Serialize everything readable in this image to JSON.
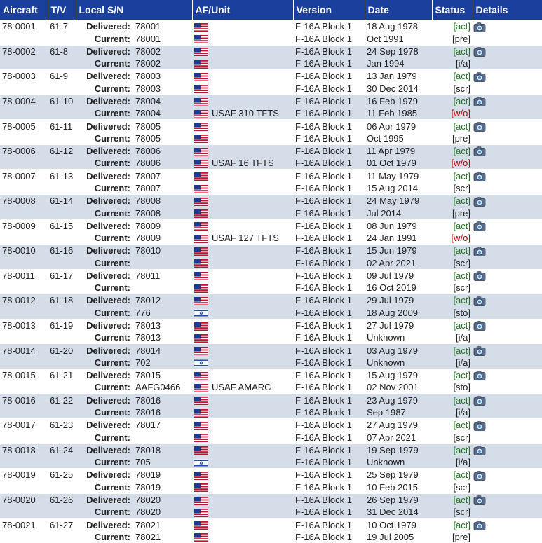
{
  "columns": [
    "Aircraft",
    "T/V",
    "Local S/N",
    "AF/Unit",
    "Version",
    "Date",
    "Status",
    "",
    "Details"
  ],
  "labels": {
    "delivered": "Delivered:",
    "current": "Current:"
  },
  "details_label": "Details",
  "rows": [
    {
      "aircraft": "78-0001",
      "tv": "61-7",
      "d_sn": "78001",
      "d_unit": "",
      "d_flag": "us",
      "d_ver": "F-16A Block 1",
      "d_date": "18 Aug 1978",
      "c_sn": "78001",
      "c_unit": "",
      "c_flag": "us",
      "c_ver": "F-16A Block 1",
      "c_date": "Oct 1991",
      "status": "[pre]",
      "status_color": "pre"
    },
    {
      "aircraft": "78-0002",
      "tv": "61-8",
      "d_sn": "78002",
      "d_unit": "",
      "d_flag": "us",
      "d_ver": "F-16A Block 1",
      "d_date": "24 Sep 1978",
      "c_sn": "78002",
      "c_unit": "",
      "c_flag": "us",
      "c_ver": "F-16A Block 1",
      "c_date": "Jan 1994",
      "status": "[i/a]",
      "status_color": "ia"
    },
    {
      "aircraft": "78-0003",
      "tv": "61-9",
      "d_sn": "78003",
      "d_unit": "",
      "d_flag": "us",
      "d_ver": "F-16A Block 1",
      "d_date": "13 Jan 1979",
      "c_sn": "78003",
      "c_unit": "",
      "c_flag": "us",
      "c_ver": "F-16A Block 1",
      "c_date": "30 Dec 2014",
      "status": "[scr]",
      "status_color": "scr"
    },
    {
      "aircraft": "78-0004",
      "tv": "61-10",
      "d_sn": "78004",
      "d_unit": "",
      "d_flag": "us",
      "d_ver": "F-16A Block 1",
      "d_date": "16 Feb 1979",
      "c_sn": "78004",
      "c_unit": "USAF 310 TFTS",
      "c_flag": "us",
      "c_ver": "F-16A Block 1",
      "c_date": "11 Feb 1985",
      "status": "[w/o]",
      "status_color": "wo"
    },
    {
      "aircraft": "78-0005",
      "tv": "61-11",
      "d_sn": "78005",
      "d_unit": "",
      "d_flag": "us",
      "d_ver": "F-16A Block 1",
      "d_date": "06 Apr 1979",
      "c_sn": "78005",
      "c_unit": "",
      "c_flag": "us",
      "c_ver": "F-16A Block 1",
      "c_date": "Oct 1995",
      "status": "[pre]",
      "status_color": "pre"
    },
    {
      "aircraft": "78-0006",
      "tv": "61-12",
      "d_sn": "78006",
      "d_unit": "",
      "d_flag": "us",
      "d_ver": "F-16A Block 1",
      "d_date": "11 Apr 1979",
      "c_sn": "78006",
      "c_unit": "USAF 16 TFTS",
      "c_flag": "us",
      "c_ver": "F-16A Block 1",
      "c_date": "01 Oct 1979",
      "status": "[w/o]",
      "status_color": "wo"
    },
    {
      "aircraft": "78-0007",
      "tv": "61-13",
      "d_sn": "78007",
      "d_unit": "",
      "d_flag": "us",
      "d_ver": "F-16A Block 1",
      "d_date": "11 May 1979",
      "c_sn": "78007",
      "c_unit": "",
      "c_flag": "us",
      "c_ver": "F-16A Block 1",
      "c_date": "15 Aug 2014",
      "status": "[scr]",
      "status_color": "scr"
    },
    {
      "aircraft": "78-0008",
      "tv": "61-14",
      "d_sn": "78008",
      "d_unit": "",
      "d_flag": "us",
      "d_ver": "F-16A Block 1",
      "d_date": "24 May 1979",
      "c_sn": "78008",
      "c_unit": "",
      "c_flag": "us",
      "c_ver": "F-16A Block 1",
      "c_date": "Jul 2014",
      "status": "[pre]",
      "status_color": "pre"
    },
    {
      "aircraft": "78-0009",
      "tv": "61-15",
      "d_sn": "78009",
      "d_unit": "",
      "d_flag": "us",
      "d_ver": "F-16A Block 1",
      "d_date": "08 Jun 1979",
      "c_sn": "78009",
      "c_unit": "USAF 127 TFTS",
      "c_flag": "us",
      "c_ver": "F-16A Block 1",
      "c_date": "24 Jan 1991",
      "status": "[w/o]",
      "status_color": "wo"
    },
    {
      "aircraft": "78-0010",
      "tv": "61-16",
      "d_sn": "78010",
      "d_unit": "",
      "d_flag": "us",
      "d_ver": "F-16A Block 1",
      "d_date": "15 Jun 1979",
      "c_sn": "",
      "c_unit": "",
      "c_flag": "us",
      "c_ver": "F-16A Block 1",
      "c_date": "02 Apr 2021",
      "status": "[scr]",
      "status_color": "scr"
    },
    {
      "aircraft": "78-0011",
      "tv": "61-17",
      "d_sn": "78011",
      "d_unit": "",
      "d_flag": "us",
      "d_ver": "F-16A Block 1",
      "d_date": "09 Jul 1979",
      "c_sn": "",
      "c_unit": "",
      "c_flag": "us",
      "c_ver": "F-16A Block 1",
      "c_date": "16 Oct 2019",
      "status": "[scr]",
      "status_color": "scr"
    },
    {
      "aircraft": "78-0012",
      "tv": "61-18",
      "d_sn": "78012",
      "d_unit": "",
      "d_flag": "us",
      "d_ver": "F-16A Block 1",
      "d_date": "29 Jul 1979",
      "c_sn": "776",
      "c_unit": "",
      "c_flag": "il",
      "c_ver": "F-16A Block 1",
      "c_date": "18 Aug 2009",
      "status": "[sto]",
      "status_color": "sto"
    },
    {
      "aircraft": "78-0013",
      "tv": "61-19",
      "d_sn": "78013",
      "d_unit": "",
      "d_flag": "us",
      "d_ver": "F-16A Block 1",
      "d_date": "27 Jul 1979",
      "c_sn": "78013",
      "c_unit": "",
      "c_flag": "us",
      "c_ver": "F-16A Block 1",
      "c_date": "Unknown",
      "status": "[i/a]",
      "status_color": "ia"
    },
    {
      "aircraft": "78-0014",
      "tv": "61-20",
      "d_sn": "78014",
      "d_unit": "",
      "d_flag": "us",
      "d_ver": "F-16A Block 1",
      "d_date": "03 Aug 1979",
      "c_sn": "702",
      "c_unit": "",
      "c_flag": "il",
      "c_ver": "F-16A Block 1",
      "c_date": "Unknown",
      "status": "[i/a]",
      "status_color": "ia"
    },
    {
      "aircraft": "78-0015",
      "tv": "61-21",
      "d_sn": "78015",
      "d_unit": "",
      "d_flag": "us",
      "d_ver": "F-16A Block 1",
      "d_date": "15 Aug 1979",
      "c_sn": "AAFG0466",
      "c_unit": "USAF AMARC",
      "c_flag": "us",
      "c_ver": "F-16A Block 1",
      "c_date": "02 Nov 2001",
      "status": "[sto]",
      "status_color": "sto"
    },
    {
      "aircraft": "78-0016",
      "tv": "61-22",
      "d_sn": "78016",
      "d_unit": "",
      "d_flag": "us",
      "d_ver": "F-16A Block 1",
      "d_date": "23 Aug 1979",
      "c_sn": "78016",
      "c_unit": "",
      "c_flag": "us",
      "c_ver": "F-16A Block 1",
      "c_date": "Sep 1987",
      "status": "[i/a]",
      "status_color": "ia"
    },
    {
      "aircraft": "78-0017",
      "tv": "61-23",
      "d_sn": "78017",
      "d_unit": "",
      "d_flag": "us",
      "d_ver": "F-16A Block 1",
      "d_date": "27 Aug 1979",
      "c_sn": "",
      "c_unit": "",
      "c_flag": "us",
      "c_ver": "F-16A Block 1",
      "c_date": "07 Apr 2021",
      "status": "[scr]",
      "status_color": "scr"
    },
    {
      "aircraft": "78-0018",
      "tv": "61-24",
      "d_sn": "78018",
      "d_unit": "",
      "d_flag": "us",
      "d_ver": "F-16A Block 1",
      "d_date": "19 Sep 1979",
      "c_sn": "705",
      "c_unit": "",
      "c_flag": "il",
      "c_ver": "F-16A Block 1",
      "c_date": "Unknown",
      "status": "[i/a]",
      "status_color": "ia"
    },
    {
      "aircraft": "78-0019",
      "tv": "61-25",
      "d_sn": "78019",
      "d_unit": "",
      "d_flag": "us",
      "d_ver": "F-16A Block 1",
      "d_date": "25 Sep 1979",
      "c_sn": "78019",
      "c_unit": "",
      "c_flag": "us",
      "c_ver": "F-16A Block 1",
      "c_date": "10 Feb 2015",
      "status": "[scr]",
      "status_color": "scr"
    },
    {
      "aircraft": "78-0020",
      "tv": "61-26",
      "d_sn": "78020",
      "d_unit": "",
      "d_flag": "us",
      "d_ver": "F-16A Block 1",
      "d_date": "26 Sep 1979",
      "c_sn": "78020",
      "c_unit": "",
      "c_flag": "us",
      "c_ver": "F-16A Block 1",
      "c_date": "31 Dec 2014",
      "status": "[scr]",
      "status_color": "scr"
    },
    {
      "aircraft": "78-0021",
      "tv": "61-27",
      "d_sn": "78021",
      "d_unit": "",
      "d_flag": "us",
      "d_ver": "F-16A Block 1",
      "d_date": "10 Oct 1979",
      "c_sn": "78021",
      "c_unit": "",
      "c_flag": "us",
      "c_ver": "F-16A Block 1",
      "c_date": "19 Jul 2005",
      "status": "[pre]",
      "status_color": "pre"
    }
  ],
  "act_label": "[act]",
  "colors": {
    "header_bg": "#1a3f9c",
    "alt_row_bg": "#d5dde8",
    "act": "#1a7a1a",
    "wo": "#c00000",
    "link": "#1f4fa8"
  },
  "icons": {
    "us": "us-flag-icon",
    "il": "israel-flag-icon",
    "camera": "camera-icon"
  }
}
